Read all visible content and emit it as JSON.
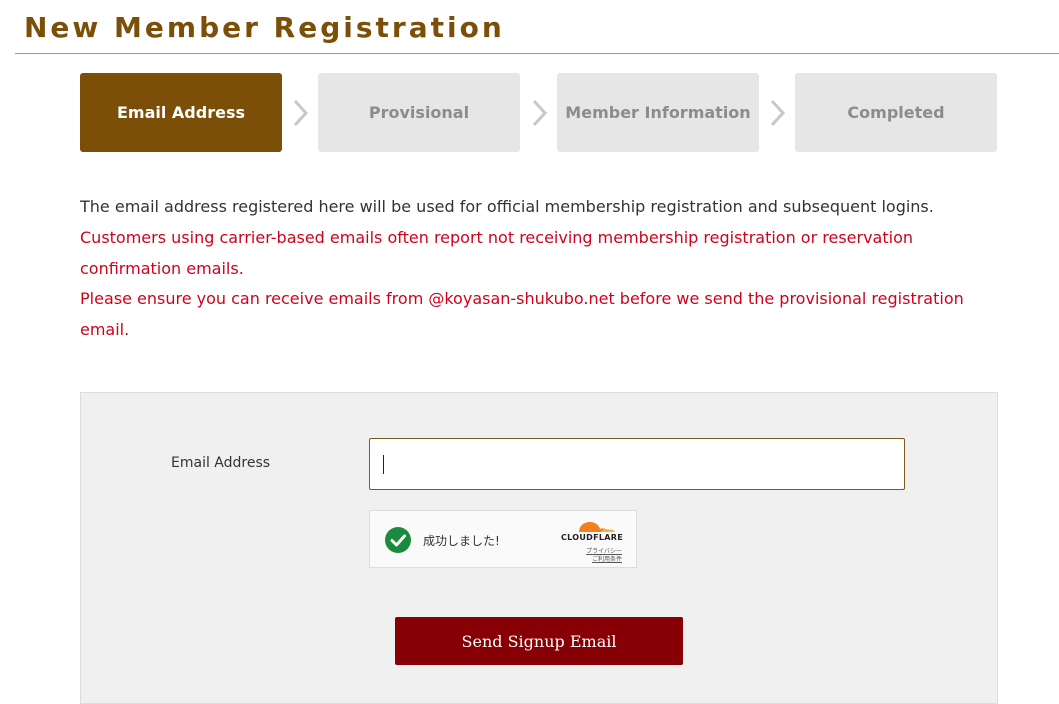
{
  "page": {
    "title": "New Member Registration"
  },
  "colors": {
    "brand": "#7b4f08",
    "accent_button": "#870005",
    "warning_text": "#d0021b",
    "rule": "#c08a5a",
    "step_inactive_bg": "#e6e6e6",
    "chevron": "#c8c8c8"
  },
  "steps": [
    {
      "label": "Email Address",
      "state": "active"
    },
    {
      "label": "Provisional",
      "state": "inactive"
    },
    {
      "label": "Member Information",
      "state": "inactive"
    },
    {
      "label": "Completed",
      "state": "inactive"
    }
  ],
  "notices": {
    "info": "The email address registered here will be used for official membership registration and subsequent logins.",
    "warning_1": "Customers using carrier-based emails often report not receiving membership registration or reservation confirmation emails.",
    "warning_2": "Please ensure you can receive emails from @koyasan-shukubo.net before we send the provisional registration email."
  },
  "form": {
    "email_label": "Email Address",
    "email_value": "",
    "email_placeholder": "",
    "submit_label": "Send Signup Email"
  },
  "captcha": {
    "status_text": "成功しました!",
    "brand": "CLOUDFLARE",
    "privacy_link": "プライバシー",
    "terms_link": "ご利用条件",
    "status_icon": "check-circle-icon"
  }
}
